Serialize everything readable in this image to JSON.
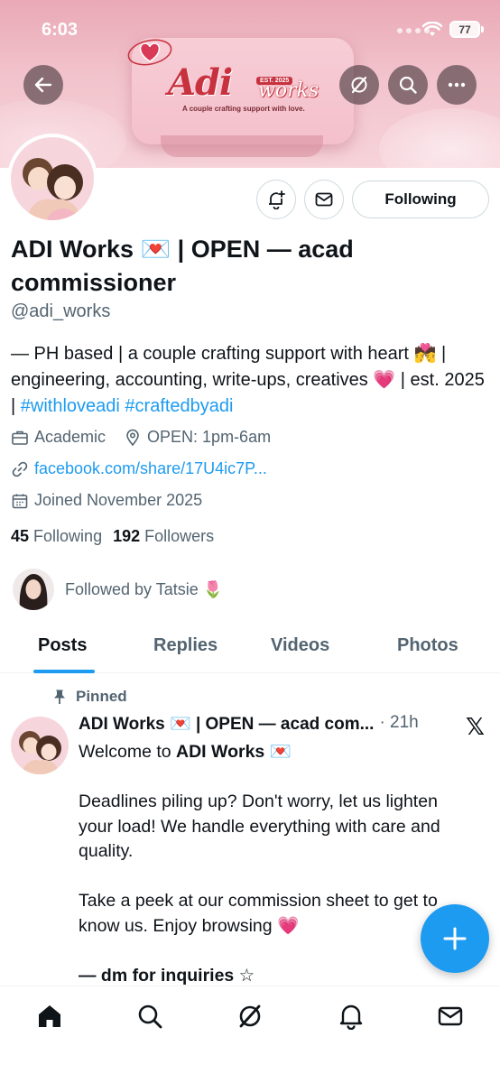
{
  "status_bar": {
    "time": "6:03",
    "battery": "77"
  },
  "banner": {
    "logo_main": "Adi",
    "logo_sub": "works",
    "logo_est": "EST. 2025",
    "tagline": "A couple crafting support with love."
  },
  "profile": {
    "name": "ADI Works 💌 | OPEN — acad commissioner",
    "handle": "@adi_works",
    "bio_text": "— PH based | a couple crafting support with heart 💏 | engineering, accounting, write-ups, creatives 💗 | est. 2025 | ",
    "bio_hashtag_1": "#withloveadi",
    "bio_hashtag_2": "#craftedbyadi",
    "category": "Academic",
    "location": "OPEN: 1pm-6am",
    "link": "facebook.com/share/17U4ic7P...",
    "joined": "Joined November 2025",
    "following_count": "45",
    "following_label": "Following",
    "followers_count": "192",
    "followers_label": "Followers",
    "followed_by": "Followed by Tatsie 🌷",
    "following_button": "Following"
  },
  "tabs": [
    "Posts",
    "Replies",
    "Videos",
    "Photos"
  ],
  "post": {
    "pinned_label": "Pinned",
    "author": "ADI Works 💌 | OPEN — acad com...",
    "time": "· 21h",
    "line1_prefix": "Welcome to ",
    "line1_bold": "ADI Works 💌",
    "para2": "Deadlines piling up? Don't worry, let us lighten your load! We handle everything with care and quality.",
    "para3": "Take a peek at our commission sheet to get to know us. Enjoy browsing 💗",
    "signature": "— dm for inquiries ☆"
  },
  "colors": {
    "accent": "#1d9bf0",
    "text": "#0f1419",
    "muted": "#536471"
  }
}
